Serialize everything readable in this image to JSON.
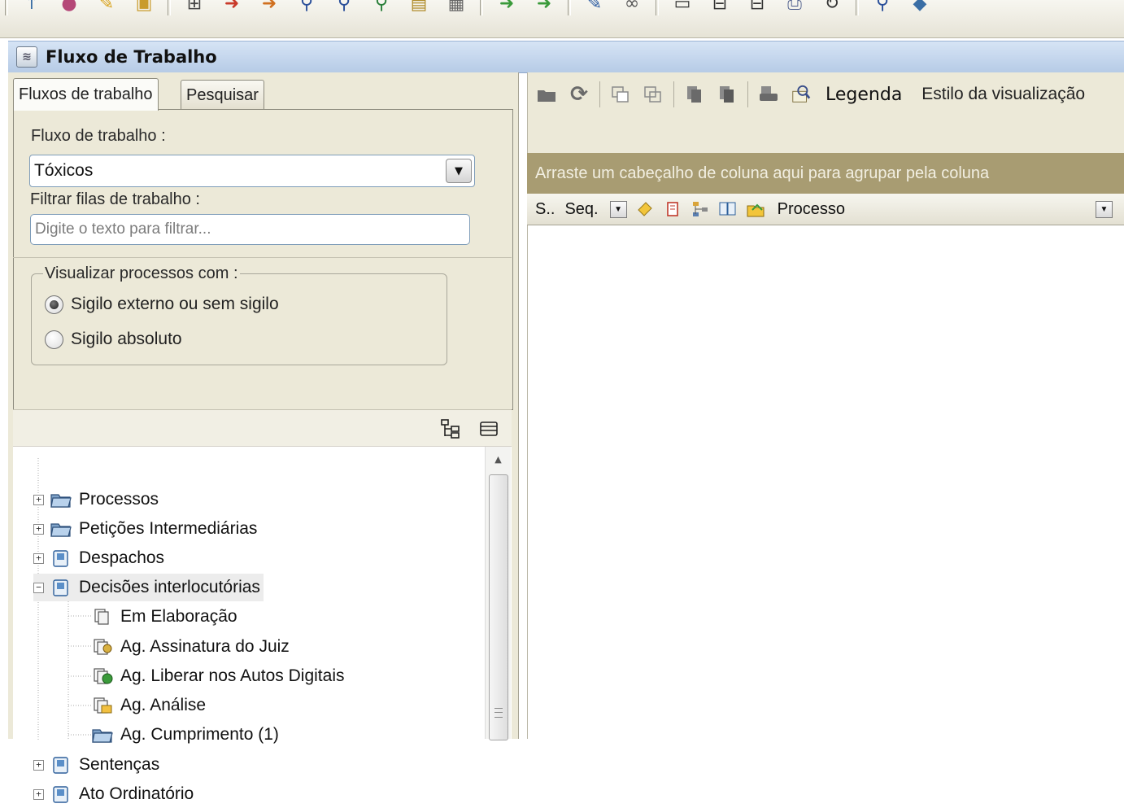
{
  "window": {
    "title": "Fluxo de Trabalho"
  },
  "left_panel": {
    "tabs": [
      {
        "label": "Fluxos de trabalho",
        "active": true
      },
      {
        "label": "Pesquisar",
        "active": false
      }
    ],
    "workflow_label": "Fluxo de trabalho :",
    "workflow_value": "Tóxicos",
    "filter_label": "Filtrar filas de trabalho :",
    "filter_placeholder": "Digite o texto para filtrar...",
    "visualizar": {
      "legend": "Visualizar processos com :",
      "options": [
        {
          "label": "Sigilo externo ou sem sigilo",
          "selected": true
        },
        {
          "label": "Sigilo absoluto",
          "selected": false
        }
      ]
    },
    "tree": [
      {
        "label": "Processos",
        "expander": "+",
        "icon": "open-folder-icon"
      },
      {
        "label": "Petições Intermediárias",
        "expander": "+",
        "icon": "open-folder-icon"
      },
      {
        "label": "Despachos",
        "expander": "+",
        "icon": "document-folder-icon"
      },
      {
        "label": "Decisões interlocutórias",
        "expander": "-",
        "icon": "document-folder-icon",
        "expanded": true,
        "highlighted": true
      },
      {
        "label": "Em Elaboração",
        "icon": "documents-draft-icon",
        "child": true
      },
      {
        "label": "Ag. Assinatura do Juiz",
        "icon": "documents-signature-icon",
        "child": true
      },
      {
        "label": "Ag. Liberar nos Autos Digitais",
        "icon": "documents-release-icon",
        "child": true
      },
      {
        "label": "Ag. Análise",
        "icon": "documents-analysis-icon",
        "child": true
      },
      {
        "label": "Ag. Cumprimento (1)",
        "icon": "open-folder-icon",
        "child": true
      },
      {
        "label": "Sentenças",
        "expander": "+",
        "icon": "document-folder-icon"
      },
      {
        "label": "Ato Ordinatório",
        "expander": "+",
        "icon": "document-folder-icon"
      }
    ]
  },
  "right_panel": {
    "legenda": "Legenda",
    "estilo": "Estilo da visualização",
    "group_hint": "Arraste um cabeçalho de coluna aqui para agrupar pela coluna",
    "columns": {
      "s": "S..",
      "seq": "Seq.",
      "processo": "Processo"
    }
  },
  "colors": {
    "group_header_bg": "#a89c72",
    "panel_bg": "#ece9d8",
    "title_bar": "#c3d5ec"
  }
}
